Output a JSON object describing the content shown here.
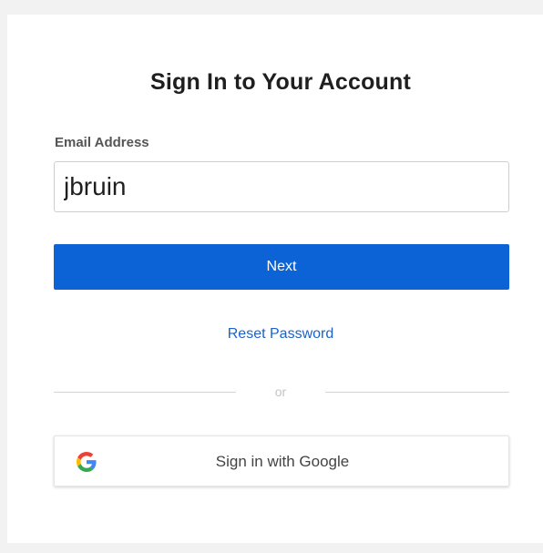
{
  "signin": {
    "title": "Sign In to Your Account",
    "email_label": "Email Address",
    "email_value": "jbruin",
    "next_label": "Next",
    "reset_label": "Reset Password",
    "divider_text": "or",
    "google_label": "Sign in with Google",
    "google_icon": "google-g-logo-icon"
  },
  "colors": {
    "primary_button": "#0b63d6",
    "link": "#1b63c6",
    "page_background": "#f2f2f2",
    "card_background": "#ffffff"
  }
}
